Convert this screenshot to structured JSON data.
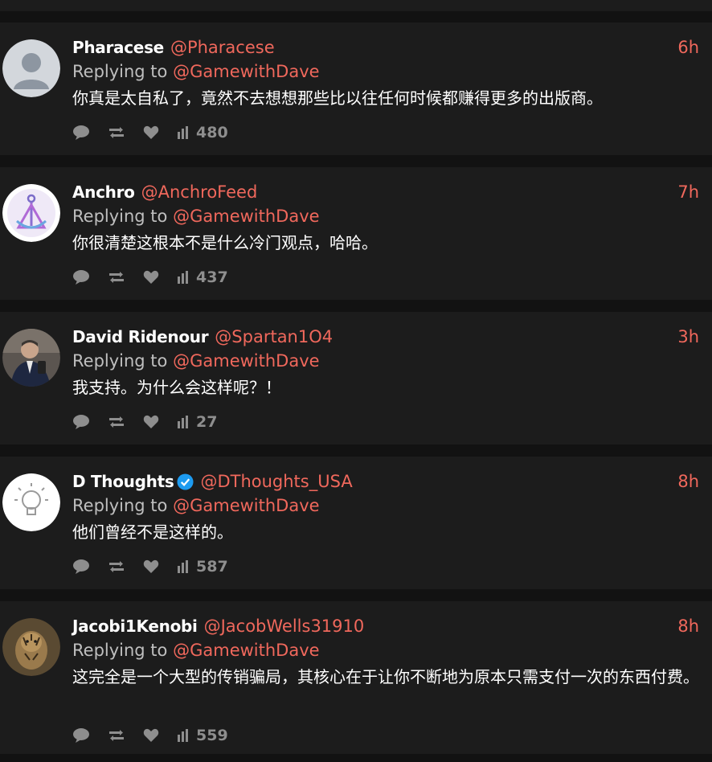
{
  "colors": {
    "accent": "#f0685c",
    "card": "#1c1c1c",
    "background": "#121212",
    "muted": "#8e8e8e"
  },
  "replies": [
    {
      "display_name": "Pharacese",
      "handle": "@Pharacese",
      "time": "6h",
      "replying_prefix": "Replying to",
      "replying_to": "@GamewithDave",
      "text": "你真是太自私了，竟然不去想想那些比以往任何时候都赚得更多的出版商。",
      "views": "480",
      "avatar": "default-person-avatar",
      "verified": false
    },
    {
      "display_name": "Anchro",
      "handle": "@AnchroFeed",
      "time": "7h",
      "replying_prefix": "Replying to",
      "replying_to": "@GamewithDave",
      "text": "你很清楚这根本不是什么冷门观点，哈哈。",
      "views": "437",
      "avatar": "anchor-logo-avatar",
      "verified": false
    },
    {
      "display_name": "David Ridenour",
      "handle": "@Spartan1O4",
      "time": "3h",
      "replying_prefix": "Replying to",
      "replying_to": "@GamewithDave",
      "text": "我支持。为什么会这样呢？！",
      "views": "27",
      "avatar": "photo-avatar",
      "verified": false
    },
    {
      "display_name": "D Thoughts",
      "handle": "@DThoughts_USA",
      "time": "8h",
      "replying_prefix": "Replying to",
      "replying_to": "@GamewithDave",
      "text": "他们曾经不是这样的。",
      "views": "587",
      "avatar": "lightbulb-avatar",
      "verified": true
    },
    {
      "display_name": "Jacobi1Kenobi",
      "handle": "@JacobWells31910",
      "time": "8h",
      "replying_prefix": "Replying to",
      "replying_to": "@GamewithDave",
      "text": "这完全是一个大型的传销骗局，其核心在于让你不断地为原本只需支付一次的东西付费。",
      "views": "559",
      "avatar": "tiger-photo-avatar",
      "verified": false
    }
  ]
}
